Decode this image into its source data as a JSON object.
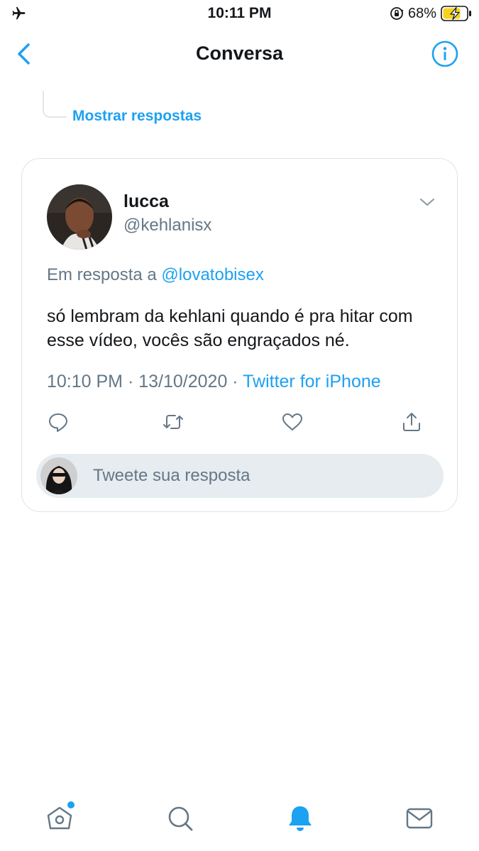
{
  "status_bar": {
    "time": "10:11 PM",
    "battery_percent": "68%",
    "icons": [
      "airplane-icon",
      "rotation-lock-icon",
      "battery-charging-icon"
    ]
  },
  "header": {
    "title": "Conversa",
    "back_icon": "chevron-left-icon",
    "info_icon": "info-icon"
  },
  "thread": {
    "show_replies_label": "Mostrar respostas"
  },
  "tweet": {
    "display_name": "lucca",
    "handle": "@kehlanisx",
    "reply_prefix": "Em resposta a ",
    "reply_mention": "@lovatobisex",
    "text": "só lembram da kehlani quando é pra hitar com esse vídeo, vocês são engraçados né.",
    "timestamp": "10:10 PM · 13/10/2020 · ",
    "source": "Twitter for iPhone",
    "actions": [
      "reply-icon",
      "retweet-icon",
      "like-icon",
      "share-icon"
    ]
  },
  "reply_box": {
    "placeholder": "Tweete sua resposta"
  },
  "tabbar": {
    "tabs": [
      "home-icon",
      "search-icon",
      "notifications-icon",
      "messages-icon"
    ],
    "active": "notifications-icon",
    "home_has_new": true
  },
  "colors": {
    "accent": "#1da1f2",
    "text": "#14171a",
    "secondary": "#657786",
    "reply_box_bg": "#e6ecf0",
    "battery_charge": "#f7d21e"
  }
}
